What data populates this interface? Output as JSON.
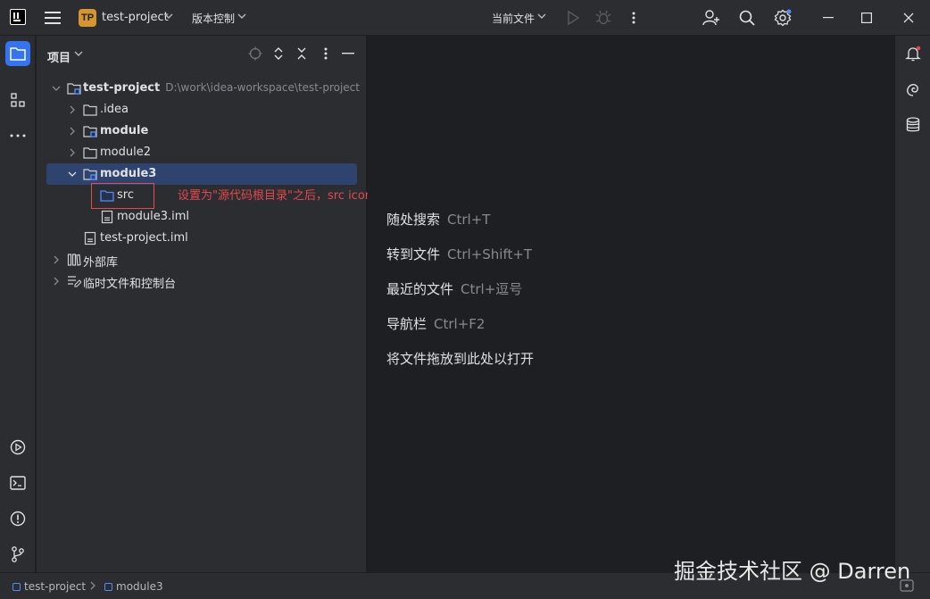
{
  "titlebar": {
    "project_badge": "TP",
    "project_name": "test-project",
    "vcs_label": "版本控制",
    "run_config": "当前文件"
  },
  "project_panel": {
    "title": "项目",
    "tree": [
      {
        "label": "test-project",
        "path": "D:\\work\\idea-workspace\\test-project",
        "bold": true,
        "icon": "module-folder-icon"
      },
      {
        "label": ".idea",
        "icon": "folder-icon"
      },
      {
        "label": "module",
        "bold": true,
        "icon": "module-folder-icon"
      },
      {
        "label": "module2",
        "icon": "folder-icon"
      },
      {
        "label": "module3",
        "bold": true,
        "icon": "module-folder-icon",
        "selected": true
      },
      {
        "label": "src",
        "icon": "source-root-folder-icon"
      },
      {
        "label": "module3.iml",
        "icon": "iml-file-icon"
      },
      {
        "label": "test-project.iml",
        "icon": "iml-file-icon"
      },
      {
        "label": "外部库",
        "icon": "library-icon"
      },
      {
        "label": "临时文件和控制台",
        "icon": "scratches-icon"
      }
    ]
  },
  "annotation": "设置为\"源代码根目录\"之后，src icon变为有颜色",
  "editor_hints": [
    {
      "action": "随处搜索",
      "shortcut": "Ctrl+T"
    },
    {
      "action": "转到文件",
      "shortcut": "Ctrl+Shift+T"
    },
    {
      "action": "最近的文件",
      "shortcut": "Ctrl+逗号"
    },
    {
      "action": "导航栏",
      "shortcut": "Ctrl+F2"
    },
    {
      "action": "将文件拖放到此处以打开",
      "shortcut": ""
    }
  ],
  "statusbar": {
    "breadcrumbs": [
      "test-project",
      "module3"
    ]
  },
  "watermark": "掘金技术社区 @ Darren",
  "colors": {
    "accent": "#3574f0",
    "selection": "#2e436e",
    "annotation_red": "#e5484d",
    "project_badge": "#d6962f",
    "source_root_blue": "#548af7"
  }
}
